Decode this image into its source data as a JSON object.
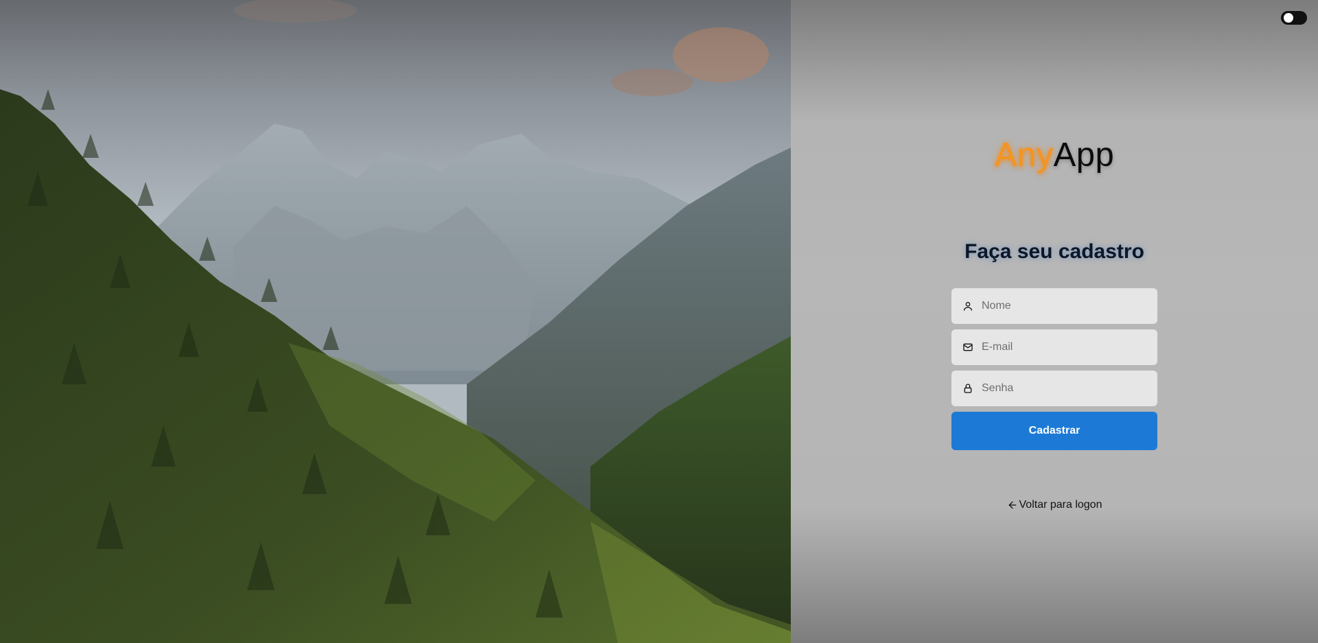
{
  "hero": {
    "alt": "mountain-forest-landscape"
  },
  "theme_toggle": {
    "state": "off"
  },
  "logo": {
    "part1": "Any",
    "part2": "App",
    "accent_color": "#f5941e"
  },
  "form": {
    "title": "Faça seu cadastro",
    "fields": [
      {
        "icon": "user-icon",
        "placeholder": "Nome",
        "value": ""
      },
      {
        "icon": "mail-icon",
        "placeholder": "E-mail",
        "value": ""
      },
      {
        "icon": "lock-icon",
        "placeholder": "Senha",
        "value": ""
      }
    ],
    "submit_label": "Cadastrar",
    "submit_color": "#1c7ad6"
  },
  "back_link": {
    "icon": "arrow-left-icon",
    "label": "Voltar para logon"
  }
}
